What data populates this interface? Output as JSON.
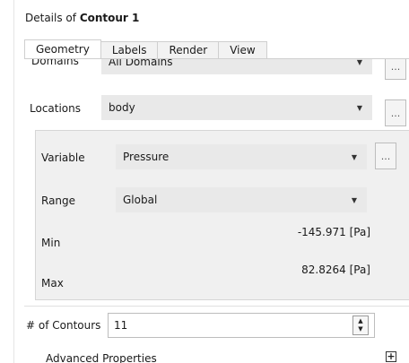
{
  "header": {
    "prefix": "Details of",
    "object_name": "Contour 1"
  },
  "tabs": [
    {
      "label": "Geometry",
      "active": true
    },
    {
      "label": "Labels",
      "active": false
    },
    {
      "label": "Render",
      "active": false
    },
    {
      "label": "View",
      "active": false
    }
  ],
  "geometry": {
    "domains": {
      "label": "Domains",
      "value": "All Domains",
      "button": "..."
    },
    "locations": {
      "label": "Locations",
      "value": "body",
      "button": "..."
    },
    "variable": {
      "label": "Variable",
      "value": "Pressure",
      "button": "..."
    },
    "range": {
      "label": "Range",
      "value": "Global"
    },
    "min": {
      "label": "Min",
      "value": "-145.971 [Pa]"
    },
    "max": {
      "label": "Max",
      "value": "82.8264 [Pa]"
    },
    "contours": {
      "label": "# of Contours",
      "value": "11"
    },
    "advanced": {
      "label": "Advanced Properties"
    }
  },
  "icons": {
    "dropdown": "chevron-down-icon",
    "spin": "spin-arrows-icon",
    "expand": "plus-box-icon"
  }
}
